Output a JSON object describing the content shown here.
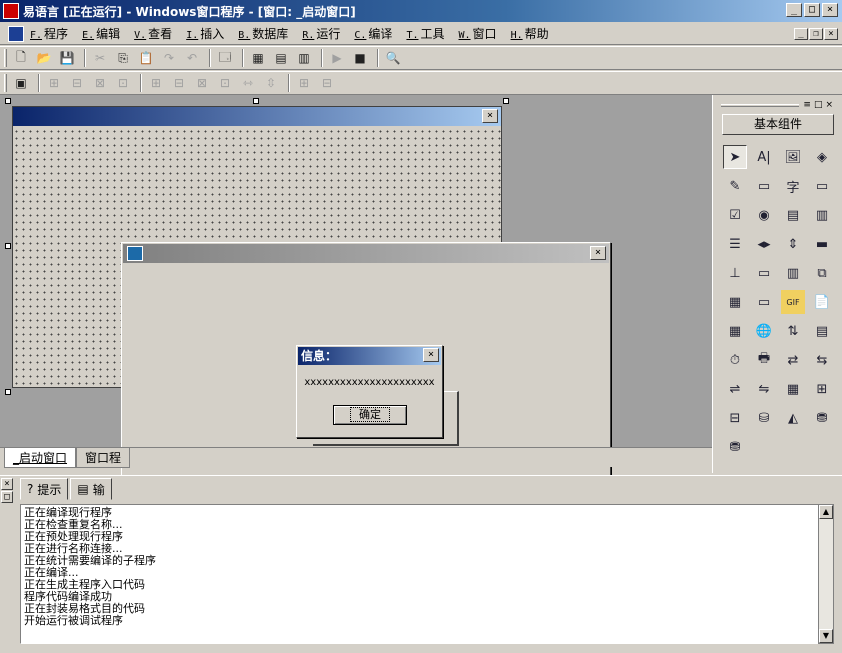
{
  "window": {
    "title": "易语言 [正在运行] - Windows窗口程序 - [窗口: _启动窗口]",
    "min_glyph": "_",
    "max_glyph": "□",
    "close_glyph": "×"
  },
  "menu": [
    {
      "acc": "F.",
      "label": "程序"
    },
    {
      "acc": "E.",
      "label": "编辑"
    },
    {
      "acc": "V.",
      "label": "查看"
    },
    {
      "acc": "I.",
      "label": "插入"
    },
    {
      "acc": "B.",
      "label": "数据库"
    },
    {
      "acc": "R.",
      "label": "运行"
    },
    {
      "acc": "C.",
      "label": "编译"
    },
    {
      "acc": "T.",
      "label": "工具"
    },
    {
      "acc": "W.",
      "label": "窗口"
    },
    {
      "acc": "H.",
      "label": "帮助"
    }
  ],
  "mdi_buttons": {
    "min": "_",
    "restore": "❐",
    "close": "×"
  },
  "toolbar1": {
    "new": "🗋",
    "open": "📂",
    "save": "💾",
    "cut": "✂",
    "copy": "⎘",
    "paste": "📋",
    "redo": "↷",
    "undo": "↶",
    "preview": "🗔",
    "view1": "▦",
    "view2": "▤",
    "view3": "▥",
    "run": "▶",
    "stop": "■",
    "find": "🔍"
  },
  "toolbar2": {
    "props": "▣",
    "a1": "⊞",
    "a2": "⊟",
    "a3": "⊠",
    "a4": "⊡",
    "a5": "⊞",
    "a6": "⊟",
    "a7": "⊠",
    "a8": "⊡",
    "a9": "⇿",
    "a10": "⇳",
    "a11": "⊞",
    "a12": "⊟"
  },
  "designer": {
    "close_glyph": "×"
  },
  "running_window": {
    "close_glyph": "×"
  },
  "msgbox": {
    "title": "信息：",
    "close_glyph": "×",
    "message": "xxxxxxxxxxxxxxxxxxxxxx",
    "ok_label": "确定"
  },
  "bottom_tabs": [
    "_启动窗口",
    "窗口程"
  ],
  "output": {
    "close_glyph": "×",
    "pin_glyph": "□",
    "tabs": [
      {
        "icon": "?",
        "label": "提示"
      },
      {
        "icon": "▤",
        "label": "输"
      }
    ],
    "lines": [
      "正在编译现行程序",
      "正在检查重复名称...",
      "正在预处理现行程序",
      "正在进行名称连接...",
      "正在统计需要编译的子程序",
      "正在编译...",
      "正在生成主程序入口代码",
      "程序代码编译成功",
      "正在封装易格式目的代码",
      "开始运行被调试程序"
    ],
    "scroll_up": "▲",
    "scroll_down": "▼"
  },
  "components_panel": {
    "title": "基本组件",
    "bar_glyphs": [
      "≡",
      "□",
      "×"
    ],
    "items": [
      {
        "name": "pointer-icon",
        "glyph": "➤"
      },
      {
        "name": "label-icon",
        "glyph": "A|"
      },
      {
        "name": "picture-icon",
        "glyph": "🖼"
      },
      {
        "name": "shape-icon",
        "glyph": "◈"
      },
      {
        "name": "edit-icon",
        "glyph": "✎"
      },
      {
        "name": "frame-icon",
        "glyph": "▭"
      },
      {
        "name": "text-icon",
        "glyph": "字"
      },
      {
        "name": "button-icon",
        "glyph": "▭"
      },
      {
        "name": "checkbox-icon",
        "glyph": "☑"
      },
      {
        "name": "radio-icon",
        "glyph": "◉"
      },
      {
        "name": "combobox-icon",
        "glyph": "▤"
      },
      {
        "name": "listbox-icon",
        "glyph": "▥"
      },
      {
        "name": "select-list-icon",
        "glyph": "☰"
      },
      {
        "name": "hscroll-icon",
        "glyph": "◂▸"
      },
      {
        "name": "vscroll-icon",
        "glyph": "⇕"
      },
      {
        "name": "progress-icon",
        "glyph": "▬"
      },
      {
        "name": "slider-icon",
        "glyph": "⊥"
      },
      {
        "name": "tabs-icon",
        "glyph": "▭"
      },
      {
        "name": "toolbar-icon",
        "glyph": "▥"
      },
      {
        "name": "timer-window-icon",
        "glyph": "⧉"
      },
      {
        "name": "calendar-icon",
        "glyph": "▦"
      },
      {
        "name": "drive-icon",
        "glyph": "▭"
      },
      {
        "name": "gif-icon",
        "glyph": "GIF"
      },
      {
        "name": "document-icon",
        "glyph": "📄"
      },
      {
        "name": "color-picker-icon",
        "glyph": "▦"
      },
      {
        "name": "globe-icon",
        "glyph": "🌐"
      },
      {
        "name": "spin-icon",
        "glyph": "⇅"
      },
      {
        "name": "grid-icon",
        "glyph": "▤"
      },
      {
        "name": "clock-icon",
        "glyph": "⏱"
      },
      {
        "name": "printer-icon",
        "glyph": "🖶"
      },
      {
        "name": "network-icon",
        "glyph": "⇄"
      },
      {
        "name": "network2-icon",
        "glyph": "⇆"
      },
      {
        "name": "client-icon",
        "glyph": "⇌"
      },
      {
        "name": "server-icon",
        "glyph": "⇋"
      },
      {
        "name": "table-icon",
        "glyph": "▦"
      },
      {
        "name": "tree-icon",
        "glyph": "⊞"
      },
      {
        "name": "db-tree-icon",
        "glyph": "⊟"
      },
      {
        "name": "db-icon",
        "glyph": "⛁"
      },
      {
        "name": "chart-icon",
        "glyph": "◭"
      },
      {
        "name": "odbc-icon",
        "glyph": "⛃"
      },
      {
        "name": "odbc2-icon",
        "glyph": "⛃"
      }
    ]
  }
}
